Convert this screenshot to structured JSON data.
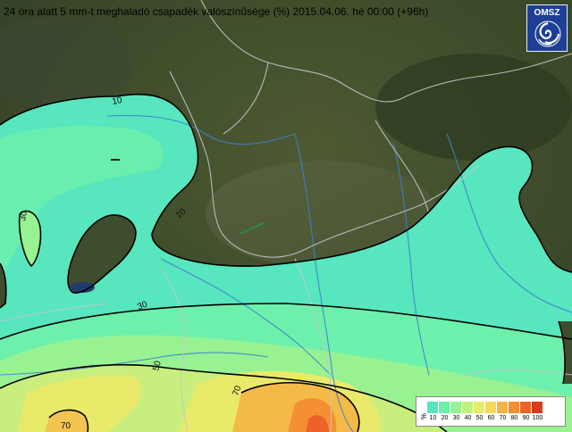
{
  "title": "24 óra alatt 5 mm-t meghaladó csapadék valószínűsége (%) 2015.04.06. hé 00:00 (+96h)",
  "logo": {
    "text": "OMSZ",
    "icon": "omsz-swirl-logo"
  },
  "legend": {
    "unit": "%",
    "labels": [
      "10",
      "20",
      "30",
      "40",
      "50",
      "60",
      "70",
      "80",
      "90",
      "100"
    ],
    "colors": [
      "#55e6c0",
      "#6af0a8",
      "#96f294",
      "#c2f080",
      "#e8ec6c",
      "#f6d85a",
      "#f6b446",
      "#f58f34",
      "#ee6228",
      "#d73c1f"
    ]
  },
  "contour_labels": [
    {
      "text": "10"
    },
    {
      "text": "30"
    },
    {
      "text": "10"
    },
    {
      "text": "30"
    },
    {
      "text": "50"
    },
    {
      "text": "70"
    },
    {
      "text": "70"
    }
  ],
  "colors": {
    "land": "#3c4a2a",
    "border": "#bfc3c8",
    "river": "#3f7fd0",
    "contour": "#000000"
  }
}
